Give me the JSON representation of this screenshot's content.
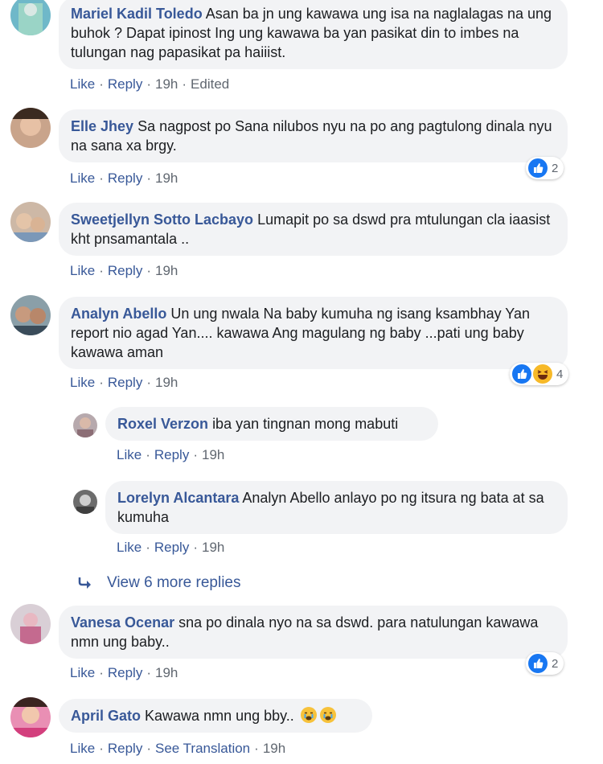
{
  "comments": [
    {
      "author": "Mariel Kadil Toledo",
      "text": "Asan ba jn ung kawawa ung isa na naglalagas na ung buhok ? Dapat ipinost Ing ung kawawa ba yan pasikat din to imbes na tulungan nag papasikat pa haiiist.",
      "like": "Like",
      "reply": "Reply",
      "time": "19h",
      "extra": "Edited"
    },
    {
      "author": "Elle Jhey",
      "text": "Sa nagpost po Sana nilubos nyu na po ang pagtulong dinala nyu na sana xa brgy.",
      "like": "Like",
      "reply": "Reply",
      "time": "19h",
      "reactions": "2"
    },
    {
      "author": "Sweetjellyn Sotto Lacbayo",
      "text": "Lumapit po sa dswd pra mtulungan cla iaasist kht pnsamantala ..",
      "like": "Like",
      "reply": "Reply",
      "time": "19h"
    },
    {
      "author": "Analyn Abello",
      "text": "Un ung nwala Na baby kumuha ng isang ksambhay Yan report nio agad Yan.... kawawa Ang magulang ng baby ...pati ung baby kawawa aman",
      "like": "Like",
      "reply": "Reply",
      "time": "19h",
      "reactions": "4"
    },
    {
      "author": "Roxel Verzon",
      "text": "iba yan tingnan mong mabuti",
      "like": "Like",
      "reply": "Reply",
      "time": "19h"
    },
    {
      "author": "Lorelyn Alcantara",
      "text": "Analyn Abello anlayo po ng itsura ng bata at sa kumuha",
      "like": "Like",
      "reply": "Reply",
      "time": "19h"
    },
    {
      "author": "Vanesa Ocenar",
      "text": "sna po dinala nyo na sa dswd. para natulungan kawawa nmn ung baby..",
      "like": "Like",
      "reply": "Reply",
      "time": "19h",
      "reactions": "2"
    },
    {
      "author": "April Gato",
      "text": "Kawawa nmn ung bby..",
      "like": "Like",
      "reply": "Reply",
      "time": "19h",
      "extra": "See Translation"
    }
  ],
  "view_more": "View 6 more replies",
  "colors": {
    "link": "#385898",
    "bubble": "#f2f3f5",
    "meta": "#606770",
    "like_blue": "#1877f2"
  }
}
